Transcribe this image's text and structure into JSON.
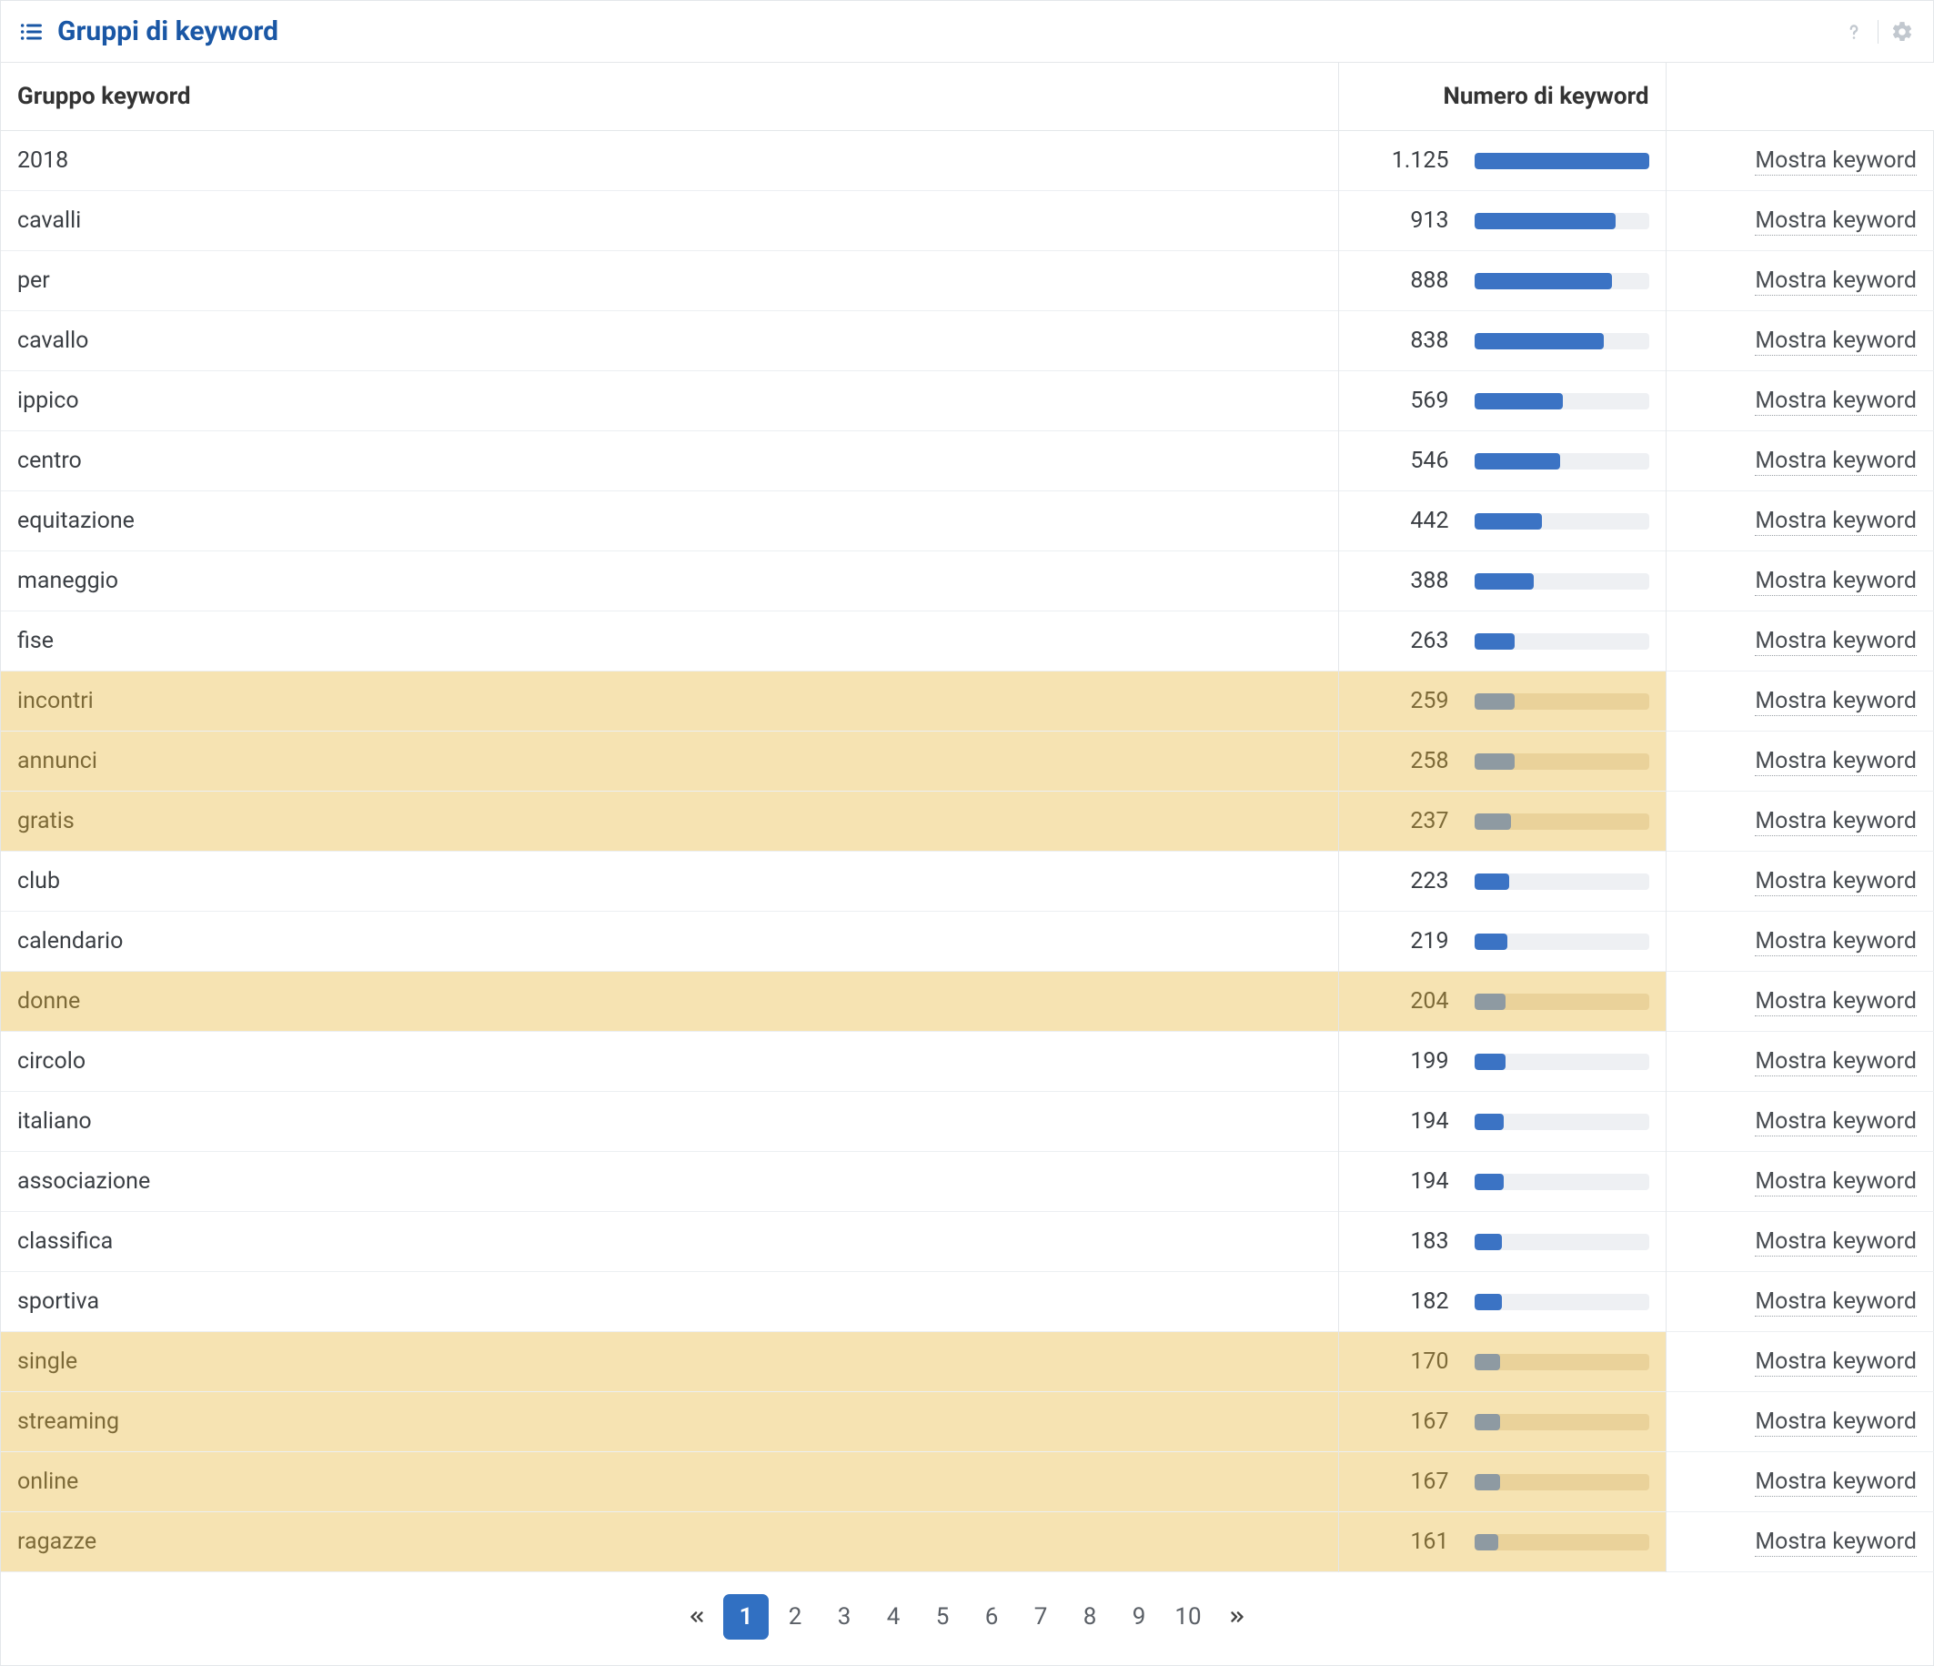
{
  "panel": {
    "title": "Gruppi di keyword"
  },
  "columns": {
    "group": "Gruppo keyword",
    "count": "Numero di keyword",
    "action": ""
  },
  "action_label": "Mostra keyword",
  "max_value": 1125,
  "rows": [
    {
      "name": "2018",
      "count": "1.125",
      "value": 1125,
      "highlight": false
    },
    {
      "name": "cavalli",
      "count": "913",
      "value": 913,
      "highlight": false
    },
    {
      "name": "per",
      "count": "888",
      "value": 888,
      "highlight": false
    },
    {
      "name": "cavallo",
      "count": "838",
      "value": 838,
      "highlight": false
    },
    {
      "name": "ippico",
      "count": "569",
      "value": 569,
      "highlight": false
    },
    {
      "name": "centro",
      "count": "546",
      "value": 546,
      "highlight": false
    },
    {
      "name": "equitazione",
      "count": "442",
      "value": 442,
      "highlight": false
    },
    {
      "name": "maneggio",
      "count": "388",
      "value": 388,
      "highlight": false
    },
    {
      "name": "fise",
      "count": "263",
      "value": 263,
      "highlight": false
    },
    {
      "name": "incontri",
      "count": "259",
      "value": 259,
      "highlight": true
    },
    {
      "name": "annunci",
      "count": "258",
      "value": 258,
      "highlight": true
    },
    {
      "name": "gratis",
      "count": "237",
      "value": 237,
      "highlight": true
    },
    {
      "name": "club",
      "count": "223",
      "value": 223,
      "highlight": false
    },
    {
      "name": "calendario",
      "count": "219",
      "value": 219,
      "highlight": false
    },
    {
      "name": "donne",
      "count": "204",
      "value": 204,
      "highlight": true
    },
    {
      "name": "circolo",
      "count": "199",
      "value": 199,
      "highlight": false
    },
    {
      "name": "italiano",
      "count": "194",
      "value": 194,
      "highlight": false
    },
    {
      "name": "associazione",
      "count": "194",
      "value": 194,
      "highlight": false
    },
    {
      "name": "classifica",
      "count": "183",
      "value": 183,
      "highlight": false
    },
    {
      "name": "sportiva",
      "count": "182",
      "value": 182,
      "highlight": false
    },
    {
      "name": "single",
      "count": "170",
      "value": 170,
      "highlight": true
    },
    {
      "name": "streaming",
      "count": "167",
      "value": 167,
      "highlight": true
    },
    {
      "name": "online",
      "count": "167",
      "value": 167,
      "highlight": true
    },
    {
      "name": "ragazze",
      "count": "161",
      "value": 161,
      "highlight": true
    }
  ],
  "pagination": {
    "pages": [
      "1",
      "2",
      "3",
      "4",
      "5",
      "6",
      "7",
      "8",
      "9",
      "10"
    ],
    "active": "1"
  }
}
